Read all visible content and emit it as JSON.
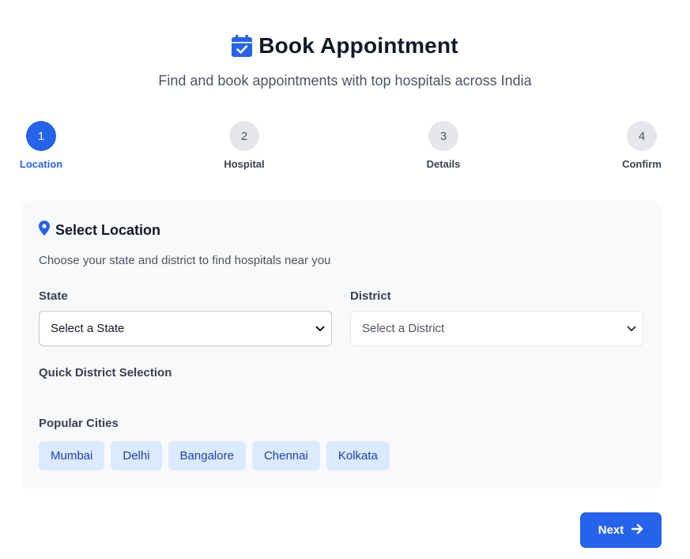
{
  "header": {
    "title": "Book Appointment",
    "subtitle": "Find and book appointments with top hospitals across India",
    "icon": "calendar-check-icon"
  },
  "stepper": {
    "active_step": 1,
    "steps": [
      {
        "number": "1",
        "label": "Location"
      },
      {
        "number": "2",
        "label": "Hospital"
      },
      {
        "number": "3",
        "label": "Details"
      },
      {
        "number": "4",
        "label": "Confirm"
      }
    ]
  },
  "location_card": {
    "title": "Select Location",
    "icon": "map-pin-icon",
    "description": "Choose your state and district to find hospitals near you",
    "state": {
      "label": "State",
      "value": "Select a State"
    },
    "district": {
      "label": "District",
      "value": "Select a District"
    },
    "quick_district_label": "Quick District Selection",
    "popular_cities_label": "Popular Cities",
    "popular_cities": [
      "Mumbai",
      "Delhi",
      "Bangalore",
      "Chennai",
      "Kolkata"
    ]
  },
  "actions": {
    "next_label": "Next",
    "next_icon": "arrow-right-icon"
  },
  "colors": {
    "primary": "#2563eb",
    "chip_bg": "#dbeafe",
    "chip_text": "#1e40af",
    "card_bg": "#f8f9fb"
  }
}
